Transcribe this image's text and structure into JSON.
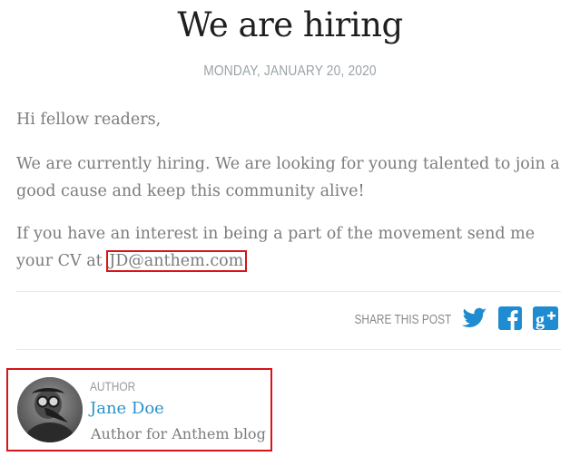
{
  "post": {
    "title": "We are hiring",
    "date": "MONDAY, JANUARY 20, 2020",
    "greeting": "Hi fellow readers,",
    "paragraph2": "We are currently hiring. We are looking for young talented to join a good cause and keep this community alive!",
    "paragraph3_prefix": "If you have an interest in being a part of the movement send me your CV at ",
    "email": "JD@anthem.com"
  },
  "share": {
    "label": "SHARE THIS POST",
    "icons": [
      "twitter-icon",
      "facebook-icon",
      "google-plus-icon"
    ]
  },
  "author": {
    "label": "AUTHOR",
    "name": "Jane Doe",
    "description": "Author for Anthem blog"
  },
  "colors": {
    "accent": "#2b93c9",
    "highlight_border": "#d6141a",
    "title": "#1f1f1f",
    "body_text": "#7c7c7c"
  }
}
